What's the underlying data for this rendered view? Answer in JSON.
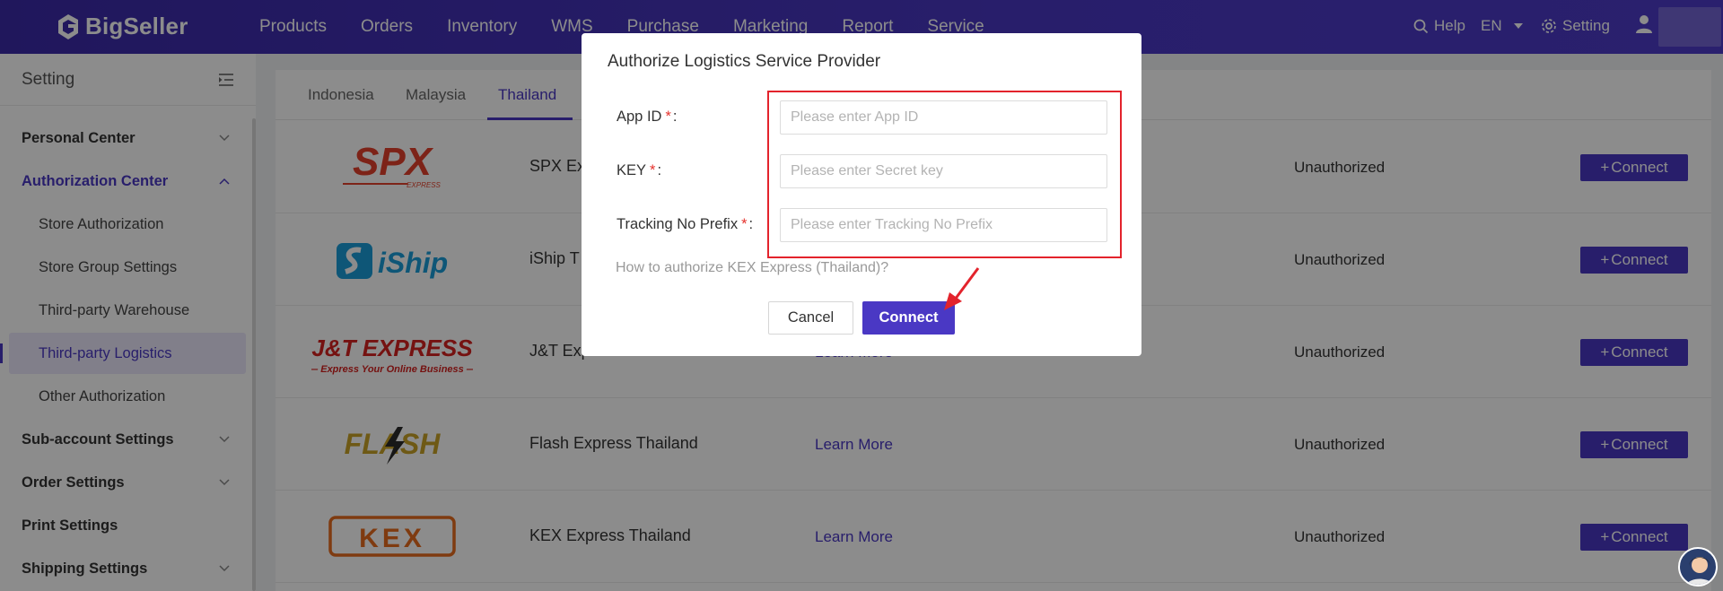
{
  "app": {
    "name": "BigSeller"
  },
  "nav": {
    "items": [
      "Products",
      "Orders",
      "Inventory",
      "WMS",
      "Purchase",
      "Marketing",
      "Report",
      "Service"
    ]
  },
  "topright": {
    "help": "Help",
    "lang": "EN",
    "setting": "Setting"
  },
  "sidebar": {
    "title": "Setting",
    "items": [
      {
        "label": "Personal Center",
        "type": "group",
        "expanded": false
      },
      {
        "label": "Authorization Center",
        "type": "group",
        "expanded": true
      },
      {
        "label": "Store Authorization",
        "type": "sub"
      },
      {
        "label": "Store Group Settings",
        "type": "sub"
      },
      {
        "label": "Third-party Warehouse",
        "type": "sub"
      },
      {
        "label": "Third-party Logistics",
        "type": "sub",
        "selected": true
      },
      {
        "label": "Other Authorization",
        "type": "sub"
      },
      {
        "label": "Sub-account Settings",
        "type": "group",
        "expanded": false
      },
      {
        "label": "Order Settings",
        "type": "group",
        "expanded": false
      },
      {
        "label": "Print Settings",
        "type": "group"
      },
      {
        "label": "Shipping Settings",
        "type": "group",
        "expanded": false
      }
    ]
  },
  "tabs": {
    "items": [
      "Indonesia",
      "Malaysia",
      "Thailand"
    ],
    "active": "Thailand"
  },
  "providers": [
    {
      "logo": "SPX",
      "logo_sub": "EXPRESS",
      "name": "SPX Ex",
      "learn": "",
      "status": "Unauthorized",
      "action": "Connect"
    },
    {
      "logo": "iShip",
      "name": "iShip T",
      "learn": "",
      "status": "Unauthorized",
      "action": "Connect"
    },
    {
      "logo": "J&T EXPRESS",
      "logo_sub": "— Express Your Online Business —",
      "name": "J&T Express Thailand",
      "learn": "Learn More",
      "status": "Unauthorized",
      "action": "Connect"
    },
    {
      "logo": "FLASH",
      "name": "Flash Express Thailand",
      "learn": "Learn More",
      "status": "Unauthorized",
      "action": "Connect"
    },
    {
      "logo": "KEX",
      "name": "KEX Express Thailand",
      "learn": "Learn More",
      "status": "Unauthorized",
      "action": "Connect"
    }
  ],
  "modal": {
    "title": "Authorize Logistics Service Provider",
    "fields": [
      {
        "label": "App ID",
        "placeholder": "Please enter App ID",
        "value": ""
      },
      {
        "label": "KEY",
        "placeholder": "Please enter Secret key",
        "value": ""
      },
      {
        "label": "Tracking No Prefix",
        "placeholder": "Please enter Tracking No Prefix",
        "value": ""
      }
    ],
    "howto": "How to authorize KEX Express (Thailand)?",
    "cancel": "Cancel",
    "connect": "Connect"
  },
  "colors": {
    "brand": "#4a38c4",
    "highlight": "#e3232c",
    "required": "#e5322d"
  }
}
